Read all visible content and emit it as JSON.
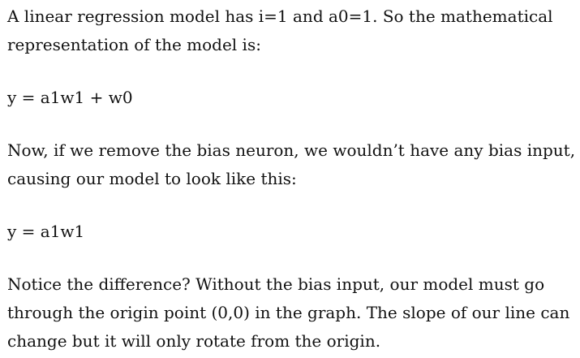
{
  "paragraphs": {
    "intro_line1": "A linear regression model has i=1 and a0=1. So the mathematical",
    "intro_line2": "representation of the model is:",
    "equation_with_bias": "y = a1w1 + w0",
    "remove_bias_line1": "Now, if we remove the bias neuron, we wouldn’t have any bias input,",
    "remove_bias_line2": "causing our model to look like this:",
    "equation_without_bias": "y = a1w1",
    "notice_line1": "Notice the difference? Without the bias input, our model must go",
    "notice_line2": "through the origin point (0,0) in the graph. The slope of our line can",
    "notice_line3": "change but it will only rotate from the origin."
  }
}
